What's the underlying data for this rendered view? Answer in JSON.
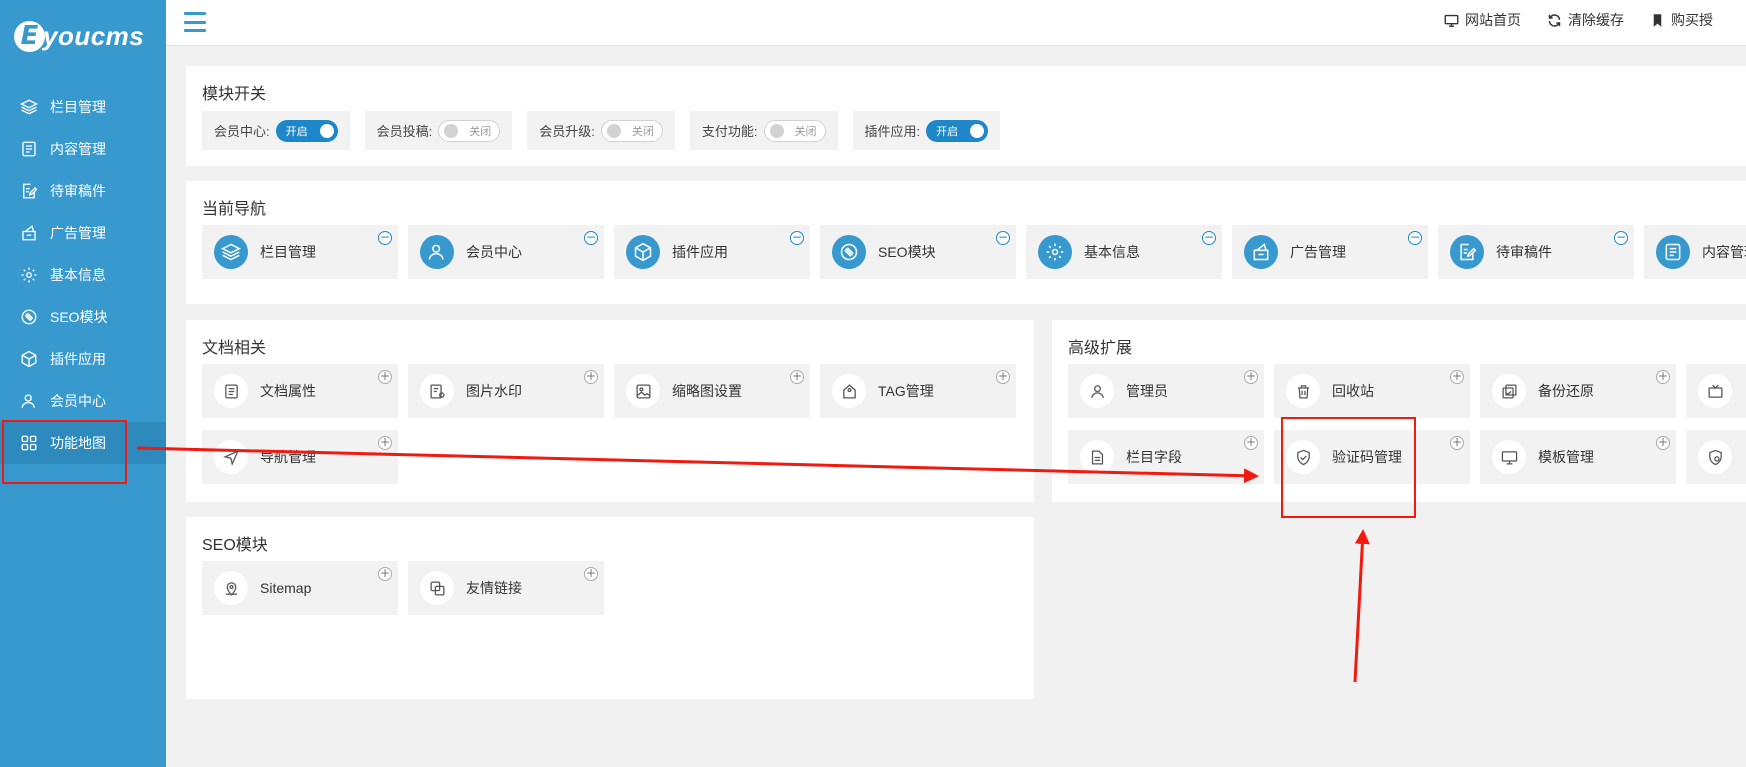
{
  "brand": {
    "logo_letter": "E",
    "logo_text": "youcms"
  },
  "sidebar": {
    "items": [
      {
        "label": "栏目管理",
        "icon": "layers-icon"
      },
      {
        "label": "内容管理",
        "icon": "document-icon"
      },
      {
        "label": "待审稿件",
        "icon": "edit-doc-icon"
      },
      {
        "label": "广告管理",
        "icon": "ad-icon"
      },
      {
        "label": "基本信息",
        "icon": "gear-icon"
      },
      {
        "label": "SEO模块",
        "icon": "seo-icon"
      },
      {
        "label": "插件应用",
        "icon": "cube-icon"
      },
      {
        "label": "会员中心",
        "icon": "user-icon"
      },
      {
        "label": "功能地图",
        "icon": "grid-icon",
        "active": true
      }
    ]
  },
  "topbar": {
    "links": [
      {
        "label": "网站首页",
        "icon": "monitor-icon"
      },
      {
        "label": "清除缓存",
        "icon": "refresh-icon"
      },
      {
        "label": "购买授",
        "icon": "bookmark-icon"
      }
    ]
  },
  "module_switch": {
    "title": "模块开关",
    "toggles": [
      {
        "label": "会员中心:",
        "state": "开启",
        "on": true
      },
      {
        "label": "会员投稿:",
        "state": "关闭",
        "on": false
      },
      {
        "label": "会员升级:",
        "state": "关闭",
        "on": false
      },
      {
        "label": "支付功能:",
        "state": "关闭",
        "on": false
      },
      {
        "label": "插件应用:",
        "state": "开启",
        "on": true
      }
    ]
  },
  "current_nav": {
    "title": "当前导航",
    "items": [
      {
        "label": "栏目管理",
        "icon": "layers-icon"
      },
      {
        "label": "会员中心",
        "icon": "user-icon"
      },
      {
        "label": "插件应用",
        "icon": "cube-icon"
      },
      {
        "label": "SEO模块",
        "icon": "seo-icon"
      },
      {
        "label": "基本信息",
        "icon": "gear-icon"
      },
      {
        "label": "广告管理",
        "icon": "ad-icon"
      },
      {
        "label": "待审稿件",
        "icon": "edit-doc-icon"
      },
      {
        "label": "内容管理",
        "icon": "document-icon"
      }
    ]
  },
  "doc_related": {
    "title": "文档相关",
    "items": [
      {
        "label": "文档属性",
        "icon": "doc-attr-icon"
      },
      {
        "label": "图片水印",
        "icon": "watermark-icon"
      },
      {
        "label": "缩略图设置",
        "icon": "image-icon"
      },
      {
        "label": "TAG管理",
        "icon": "tag-icon"
      },
      {
        "label": "导航管理",
        "icon": "navigation-icon"
      }
    ]
  },
  "advanced": {
    "title": "高级扩展",
    "items": [
      {
        "label": "管理员",
        "icon": "user-icon"
      },
      {
        "label": "回收站",
        "icon": "trash-icon"
      },
      {
        "label": "备份还原",
        "icon": "backup-icon"
      },
      {
        "label": "",
        "icon": "tv-icon"
      },
      {
        "label": "栏目字段",
        "icon": "field-icon"
      },
      {
        "label": "验证码管理",
        "icon": "shield-check-icon"
      },
      {
        "label": "模板管理",
        "icon": "monitor-icon"
      },
      {
        "label": "",
        "icon": "shield-gear-icon"
      }
    ]
  },
  "seo_module": {
    "title": "SEO模块",
    "items": [
      {
        "label": "Sitemap",
        "icon": "map-icon"
      },
      {
        "label": "友情链接",
        "icon": "link-icon"
      }
    ]
  },
  "colors": {
    "sidebar": "#3899cf",
    "accent": "#1e87c9",
    "annotation": "#f01a10"
  }
}
